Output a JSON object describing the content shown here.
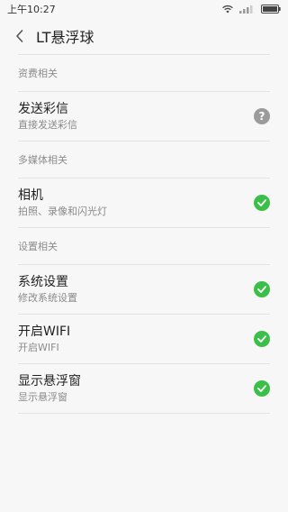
{
  "status_bar": {
    "time": "上午10:27"
  },
  "header": {
    "title": "LT悬浮球"
  },
  "sections": [
    {
      "label": "资费相关",
      "items": [
        {
          "title": "发送彩信",
          "subtitle": "直接发送彩信",
          "status": "help",
          "status_glyph": "?"
        }
      ]
    },
    {
      "label": "多媒体相关",
      "items": [
        {
          "title": "相机",
          "subtitle": "拍照、录像和闪光灯",
          "status": "check"
        }
      ]
    },
    {
      "label": "设置相关",
      "items": [
        {
          "title": "系统设置",
          "subtitle": "修改系统设置",
          "status": "check"
        },
        {
          "title": "开启WIFI",
          "subtitle": "开启WIFI",
          "status": "check"
        },
        {
          "title": "显示悬浮窗",
          "subtitle": "显示悬浮窗",
          "status": "check"
        }
      ]
    }
  ],
  "colors": {
    "check": "#3cbf4a",
    "help": "#9b9b9b",
    "background": "#f7f7f7"
  },
  "icons": {
    "back": "chevron-left-icon",
    "check": "check-circle-icon",
    "help": "question-circle-icon",
    "wifi": "wifi-icon",
    "signal": "signal-icon",
    "battery": "battery-icon"
  }
}
